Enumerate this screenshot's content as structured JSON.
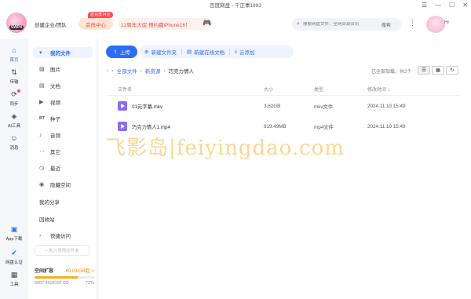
{
  "window": {
    "title": "百度网盘 - 千正事1993",
    "controls": [
      "☰",
      "—",
      "☐",
      "✕"
    ]
  },
  "header": {
    "logo_text": "SWP4",
    "create_team": "创建企业/团队",
    "member_btn": "会员中心",
    "member_tag": "首充低74元",
    "promo": "12周年大促 预约赢iPhone16！",
    "search_placeholder": "搜索网盘文件、全网资源资讯",
    "search_btn": "搜索",
    "greeting": "Hi"
  },
  "rail": [
    {
      "label": "首页",
      "icon": "home-icon",
      "glyph": "⌂",
      "active": true
    },
    {
      "label": "传输",
      "icon": "transfer-icon",
      "glyph": "⇅",
      "active": false
    },
    {
      "label": "同步",
      "icon": "sync-icon",
      "glyph": "⟳",
      "active": false
    },
    {
      "label": "AI工具",
      "icon": "ai-icon",
      "glyph": "◈",
      "active": false
    },
    {
      "label": "消息",
      "icon": "message-icon",
      "glyph": "☺",
      "active": false
    },
    {
      "label": "App下载",
      "icon": "app-icon",
      "glyph": "▣",
      "active": false
    },
    {
      "label": "网盘认证",
      "icon": "verify-icon",
      "glyph": "✔",
      "active": false
    },
    {
      "label": "工具",
      "icon": "tools-icon",
      "glyph": "▦",
      "active": false
    }
  ],
  "sidebar": {
    "my_files": "我的文件",
    "items": [
      {
        "label": "图片",
        "glyph": "▨"
      },
      {
        "label": "文档",
        "glyph": "▤"
      },
      {
        "label": "视频",
        "glyph": "▶"
      },
      {
        "label": "种子",
        "glyph": "BT"
      },
      {
        "label": "音频",
        "glyph": "♪"
      },
      {
        "label": "其它",
        "glyph": "⋯"
      },
      {
        "label": "最近",
        "glyph": "◷"
      },
      {
        "label": "隐藏空间",
        "glyph": "◉"
      }
    ],
    "my_share": "我的分享",
    "recycle": "回收站",
    "quick_access": "快捷访问",
    "add_fav": "+ 拖入常用文件夹",
    "storage": {
      "label": "空间扩容",
      "price": "¥0.03/GB起 >",
      "used": "5907.4G/8197.0G",
      "percent": "72%",
      "fraction": 0.72
    }
  },
  "toolbar": {
    "upload": "上传",
    "new_folder": "新建文件夹",
    "new_doc": "新建在线文档",
    "cloud_add": "云添加"
  },
  "breadcrumb": {
    "root": "全部文件",
    "mid": "新资源",
    "current": "巧克力情人"
  },
  "status": {
    "loaded": "已全部加载，共2个"
  },
  "table": {
    "headers": {
      "name": "文件名",
      "size": "大小",
      "type": "类型",
      "time": "修改时间"
    },
    "rows": [
      {
        "name": "01元字幕.mkv",
        "size": "3.62GB",
        "type": "mkv文件",
        "time": "2024.11.10 15:49"
      },
      {
        "name": "巧克力情人1.mp4",
        "size": "919.49MB",
        "type": "mp4文件",
        "time": "2024.11.10 15:49"
      }
    ]
  },
  "watermark": "飞影岛|feiyingdao.com"
}
